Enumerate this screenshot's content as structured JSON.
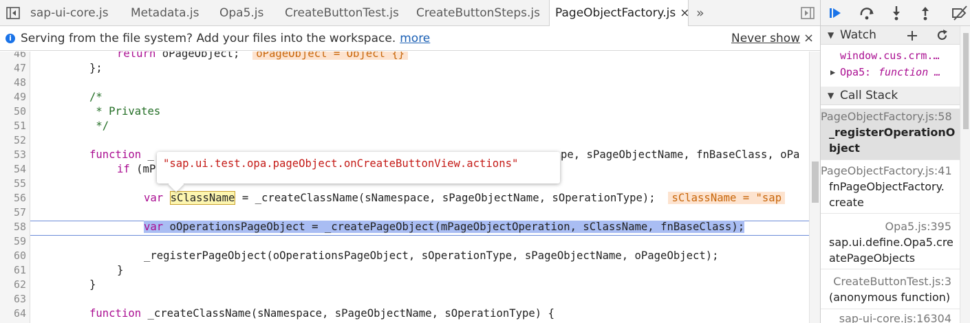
{
  "tabs": [
    {
      "label": "sap-ui-core.js"
    },
    {
      "label": "Metadata.js"
    },
    {
      "label": "Opa5.js"
    },
    {
      "label": "CreateButtonTest.js"
    },
    {
      "label": "CreateButtonSteps.js"
    },
    {
      "label": "PageObjectFactory.js",
      "active": true
    }
  ],
  "tab_close": "×",
  "tab_overflow": "»",
  "infobar": {
    "message": "Serving from the file system? Add your files into the workspace.",
    "link": "more",
    "dismiss": "Never show",
    "close": "×"
  },
  "gutter": [
    "46",
    "47",
    "48",
    "49",
    "50",
    "51",
    "52",
    "53",
    "54",
    "55",
    "56",
    "57",
    "58",
    "59",
    "60",
    "61",
    "62",
    "63",
    "64"
  ],
  "code": {
    "l46_kw": "return",
    "l46_rest": " oPageObject;",
    "l46_val": "oPageObject = Object {}",
    "l47": "};",
    "l49": "/*",
    "l50": " * Privates",
    "l51": " */",
    "l53_kw": "function",
    "l53_pre": " _",
    "l53_rest": "pe, sPageObjectName, fnBaseClass, oPa",
    "l54_kw": "if",
    "l54_rest": " (mP",
    "l56_kw": "var",
    "l56_var": "sClassName",
    "l56_rest": " = _createClassName(sNamespace, sPageObjectName, sOperationType);",
    "l56_val": "sClassName = \"sap",
    "l58_kw": "var",
    "l58_rest": " oOperationsPageObject = _createPageObject(mPageObjectOperation, sClassName, fnBaseClass);",
    "l60": "_registerPageObject(oOperationsPageObject, sOperationType, sPageObjectName, oPageObject);",
    "l61": "}",
    "l62": "}",
    "l64_kw": "function",
    "l64_rest": " _createClassName(sNamespace, sPageObjectName, sOperationType) {"
  },
  "tooltip": "\"sap.ui.test.opa.pageObject.onCreateButtonView.actions\"",
  "watch": {
    "title": "Watch",
    "items": [
      {
        "expr": "window.cus.crm.…"
      },
      {
        "name": "Opa5",
        "value": "function …"
      }
    ]
  },
  "call_stack": {
    "title": "Call Stack",
    "frames": [
      {
        "loc": "PageObjectFactory.js:58",
        "fn": [
          "_registerOperationO",
          "bject"
        ],
        "active": true
      },
      {
        "loc": "PageObjectFactory.js:41",
        "fn": [
          "fnPageObjectFactory.",
          "create"
        ]
      },
      {
        "loc": "Opa5.js:395",
        "fn": [
          "sap.ui.define.Opa5.cre",
          "atePageObjects"
        ]
      },
      {
        "loc": "CreateButtonTest.js:3",
        "fn": [
          "(anonymous function)"
        ]
      },
      {
        "loc": "sap-ui-core.js:16304",
        "fn": []
      }
    ]
  },
  "colors": {
    "keyword": "#aa0d91",
    "comment": "#236e25",
    "string": "#c41a16",
    "selection": "#a9bdf3",
    "link": "#1a5fb4"
  }
}
